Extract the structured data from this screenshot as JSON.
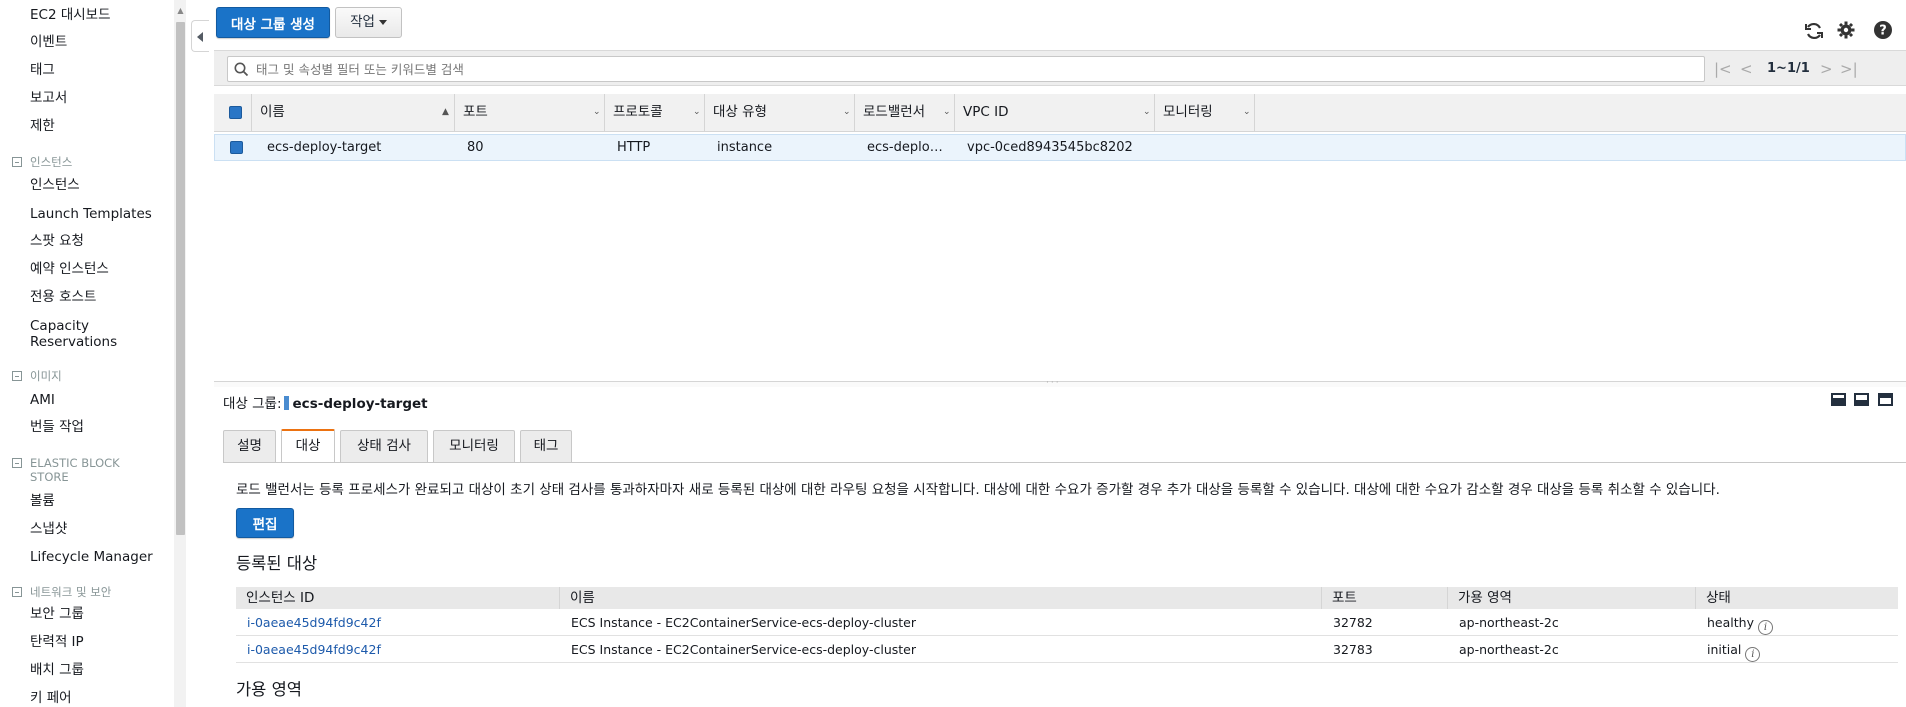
{
  "sidebar": {
    "items_top": [
      {
        "label": "EC2 대시보드"
      },
      {
        "label": "이벤트"
      },
      {
        "label": "태그"
      },
      {
        "label": "보고서"
      },
      {
        "label": "제한"
      }
    ],
    "sections": [
      {
        "title": "인스턴스",
        "items": [
          "인스턴스",
          "Launch Templates",
          "스팟 요청",
          "예약 인스턴스",
          "전용 호스트",
          "Capacity Reservations"
        ]
      },
      {
        "title": "이미지",
        "items": [
          "AMI",
          "번들 작업"
        ]
      },
      {
        "title": "ELASTIC BLOCK STORE",
        "items": [
          "볼륨",
          "스냅샷",
          "Lifecycle Manager"
        ]
      },
      {
        "title": "네트워크 및 보안",
        "items": [
          "보안 그룹",
          "탄력적 IP",
          "배치 그룹",
          "키 페어"
        ]
      }
    ]
  },
  "toolbar": {
    "create_label": "대상 그룹 생성",
    "actions_label": "작업"
  },
  "search": {
    "placeholder": "태그 및 속성별 필터 또는 키워드별 검색"
  },
  "pager": {
    "range": "1~1/1"
  },
  "table": {
    "columns": [
      "이름",
      "포트",
      "프로토콜",
      "대상 유형",
      "로드밸런서",
      "VPC ID",
      "모니터링"
    ],
    "rows": [
      {
        "name": "ecs-deploy-target",
        "port": "80",
        "protocol": "HTTP",
        "target_type": "instance",
        "load_balancer": "ecs-deploy-alb",
        "vpc": "vpc-0ced8943545bc8202",
        "monitoring": ""
      }
    ]
  },
  "detail": {
    "title_prefix": "대상 그룹:",
    "title_name": "ecs-deploy-target",
    "tabs": [
      "설명",
      "대상",
      "상태 검사",
      "모니터링",
      "태그"
    ],
    "active_tab": 1,
    "description": "로드 밸런서는 등록 프로세스가 완료되고 대상이 초기 상태 검사를 통과하자마자 새로 등록된 대상에 대한 라우팅 요청을 시작합니다. 대상에 대한 수요가 증가할 경우 추가 대상을 등록할 수 있습니다. 대상에 대한 수요가 감소할 경우 대상을 등록 취소할 수 있습니다.",
    "edit_label": "편집",
    "registered_heading": "등록된 대상",
    "registered_columns": [
      "인스턴스 ID",
      "이름",
      "포트",
      "가용 영역",
      "상태"
    ],
    "registered_rows": [
      {
        "instance_id": "i-0aeae45d94fd9c42f",
        "name": "ECS Instance - EC2ContainerService-ecs-deploy-cluster",
        "port": "32782",
        "az": "ap-northeast-2c",
        "status": "healthy"
      },
      {
        "instance_id": "i-0aeae45d94fd9c42f",
        "name": "ECS Instance - EC2ContainerService-ecs-deploy-cluster",
        "port": "32783",
        "az": "ap-northeast-2c",
        "status": "initial"
      }
    ],
    "az_heading": "가용 영역"
  },
  "colors": {
    "primary_button": "#1a73c8",
    "selected_row": "#ebf4fc",
    "active_tab_accent": "#ec7211",
    "link": "#1d5aab"
  }
}
